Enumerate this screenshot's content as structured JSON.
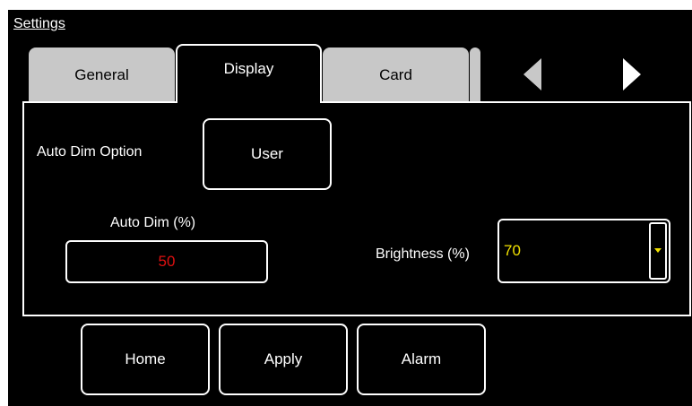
{
  "window": {
    "title": "Settings"
  },
  "tabs": [
    {
      "label": "General",
      "active": false
    },
    {
      "label": "Display",
      "active": true
    },
    {
      "label": "Card",
      "active": false
    },
    {
      "label": "",
      "active": false
    }
  ],
  "nav": {
    "prev_icon": "triangle-left-icon",
    "next_icon": "triangle-right-icon"
  },
  "display_panel": {
    "auto_dim_option_label": "Auto Dim Option",
    "auto_dim_option_value": "User",
    "auto_dim_label": "Auto Dim (%)",
    "auto_dim_value": "50",
    "brightness_label": "Brightness (%)",
    "brightness_value": "70"
  },
  "footer": {
    "home_label": "Home",
    "apply_label": "Apply",
    "alarm_label": "Alarm"
  },
  "colors": {
    "background": "#000000",
    "tab_inactive": "#c8c8c8",
    "auto_dim_value": "#e01010",
    "brightness_value": "#f0e000"
  }
}
